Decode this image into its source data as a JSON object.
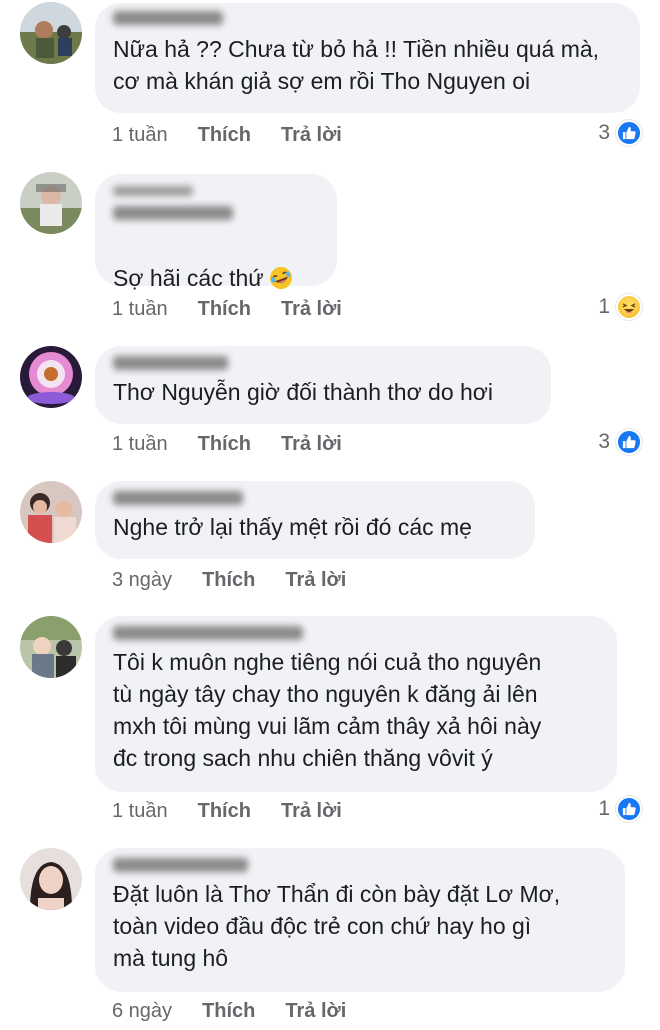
{
  "comments": [
    {
      "text": "Nữa hả ?? Chưa từ bỏ hả !! Tiền nhiều quá mà, cơ mà khán giả sợ em rồi Tho Nguyen oi",
      "time": "1 tuần",
      "like": "Thích",
      "reply": "Trả lời",
      "reaction_count": "3",
      "reaction_icon": "like-icon"
    },
    {
      "text": "Sợ hãi các thứ",
      "emoji_icon": "rofl-emoji-icon",
      "time": "1 tuần",
      "like": "Thích",
      "reply": "Trả lời",
      "reaction_count": "1",
      "reaction_icon": "haha-icon"
    },
    {
      "text": "Thơ Nguyễn giờ đối thành thơ do hơi",
      "time": "1 tuần",
      "like": "Thích",
      "reply": "Trả lời",
      "reaction_count": "3",
      "reaction_icon": "like-icon"
    },
    {
      "text": "Nghe trở lại thấy mệt rồi đó các mẹ",
      "time": "3 ngày",
      "like": "Thích",
      "reply": "Trả lời"
    },
    {
      "text": "Tôi k muôn nghe tiêng nói cuả tho nguyên\ntù ngày tây chay tho nguyên k đăng ải lên\nmxh  tôi mùng vui lãm cảm thây xả hôi này\nđc trong sach nhu chiên thăng vôvit ý",
      "time": "1 tuần",
      "like": "Thích",
      "reply": "Trả lời",
      "reaction_count": "1",
      "reaction_icon": "like-icon"
    },
    {
      "text": "Đặt luôn là Thơ Thẩn đi còn bày đặt Lơ Mơ,\ntoàn video đầu độc trẻ con chứ hay ho gì\nmà tung hô",
      "time": "6 ngày",
      "like": "Thích",
      "reply": "Trả lời"
    }
  ],
  "colors": {
    "bubble": "#f0f2f5",
    "meta": "#65676b",
    "like_blue": "#1877f2",
    "haha_yellow": "#f7b928"
  }
}
